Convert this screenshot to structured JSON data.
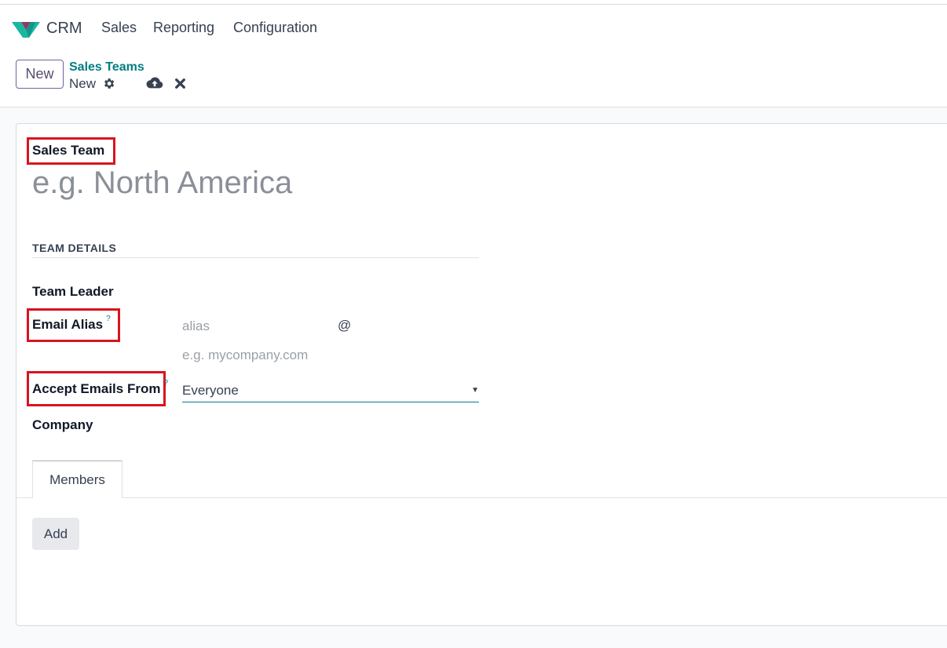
{
  "navbar": {
    "app_name": "CRM",
    "menu": [
      "Sales",
      "Reporting",
      "Configuration"
    ]
  },
  "control_panel": {
    "new_button": "New",
    "breadcrumb_parent": "Sales Teams",
    "breadcrumb_current": "New"
  },
  "icons": {
    "logo": "crm-logo-icon",
    "settings": "gear-icon",
    "save": "cloud-upload-icon",
    "discard": "close-icon"
  },
  "form": {
    "name_label": "Sales Team",
    "name_placeholder": "e.g. North America",
    "section_title": "TEAM DETAILS",
    "team_leader_label": "Team Leader",
    "email_alias_label": "Email Alias",
    "help_mark": "?",
    "alias_placeholder": "alias",
    "at_sign": "@",
    "domain_placeholder": "e.g. mycompany.com",
    "accept_emails_label": "Accept Emails From",
    "accept_emails_value": "Everyone",
    "company_label": "Company"
  },
  "tabs": [
    "Members"
  ],
  "members": {
    "add_button": "Add"
  },
  "colors": {
    "accent_teal": "#017e84",
    "brand_purple": "#71639e",
    "highlight_red": "#d7151e"
  }
}
